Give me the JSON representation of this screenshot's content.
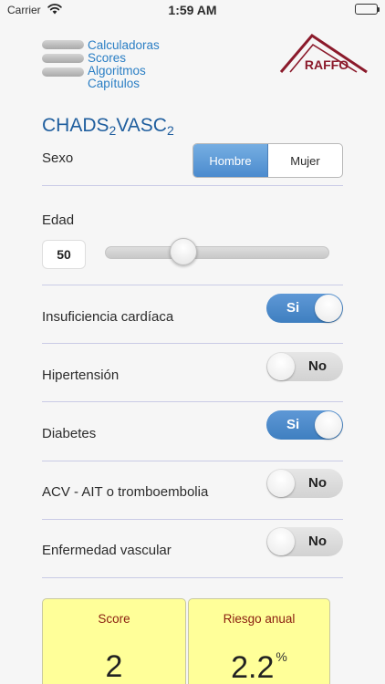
{
  "status_bar": {
    "carrier": "Carrier",
    "time": "1:59 AM"
  },
  "menu": {
    "items": [
      "Calculadoras",
      "Scores",
      "Algoritmos",
      "Capítulos"
    ]
  },
  "logo": {
    "text": "RAFFO",
    "color": "#8b1a2b"
  },
  "calculator": {
    "title_main": "CHADS",
    "sub1": "2",
    "title_mid": "VASC",
    "sub2": "2"
  },
  "sexo": {
    "label": "Sexo",
    "options": [
      "Hombre",
      "Mujer"
    ],
    "selected": "Hombre"
  },
  "edad": {
    "label": "Edad",
    "value": "50",
    "slider_fraction": 0.33
  },
  "factors": [
    {
      "label": "Insuficiencia cardíaca",
      "value": "Si",
      "on": true
    },
    {
      "label": "Hipertensión",
      "value": "No",
      "on": false
    },
    {
      "label": "Diabetes",
      "value": "Si",
      "on": true
    },
    {
      "label": "ACV - AIT o tromboembolia",
      "value": "No",
      "on": false
    },
    {
      "label": "Enfermedad vascular",
      "value": "No",
      "on": false
    }
  ],
  "results": {
    "score": {
      "title": "Score",
      "value": "2"
    },
    "risk": {
      "title": "Riesgo anual",
      "value": "2.2",
      "unit": "%"
    }
  },
  "colors": {
    "accent": "#4b8bce",
    "link": "#2a7ec4",
    "title": "#1f5e9e",
    "card_bg": "#ffff99",
    "card_title": "#8a1f10"
  }
}
